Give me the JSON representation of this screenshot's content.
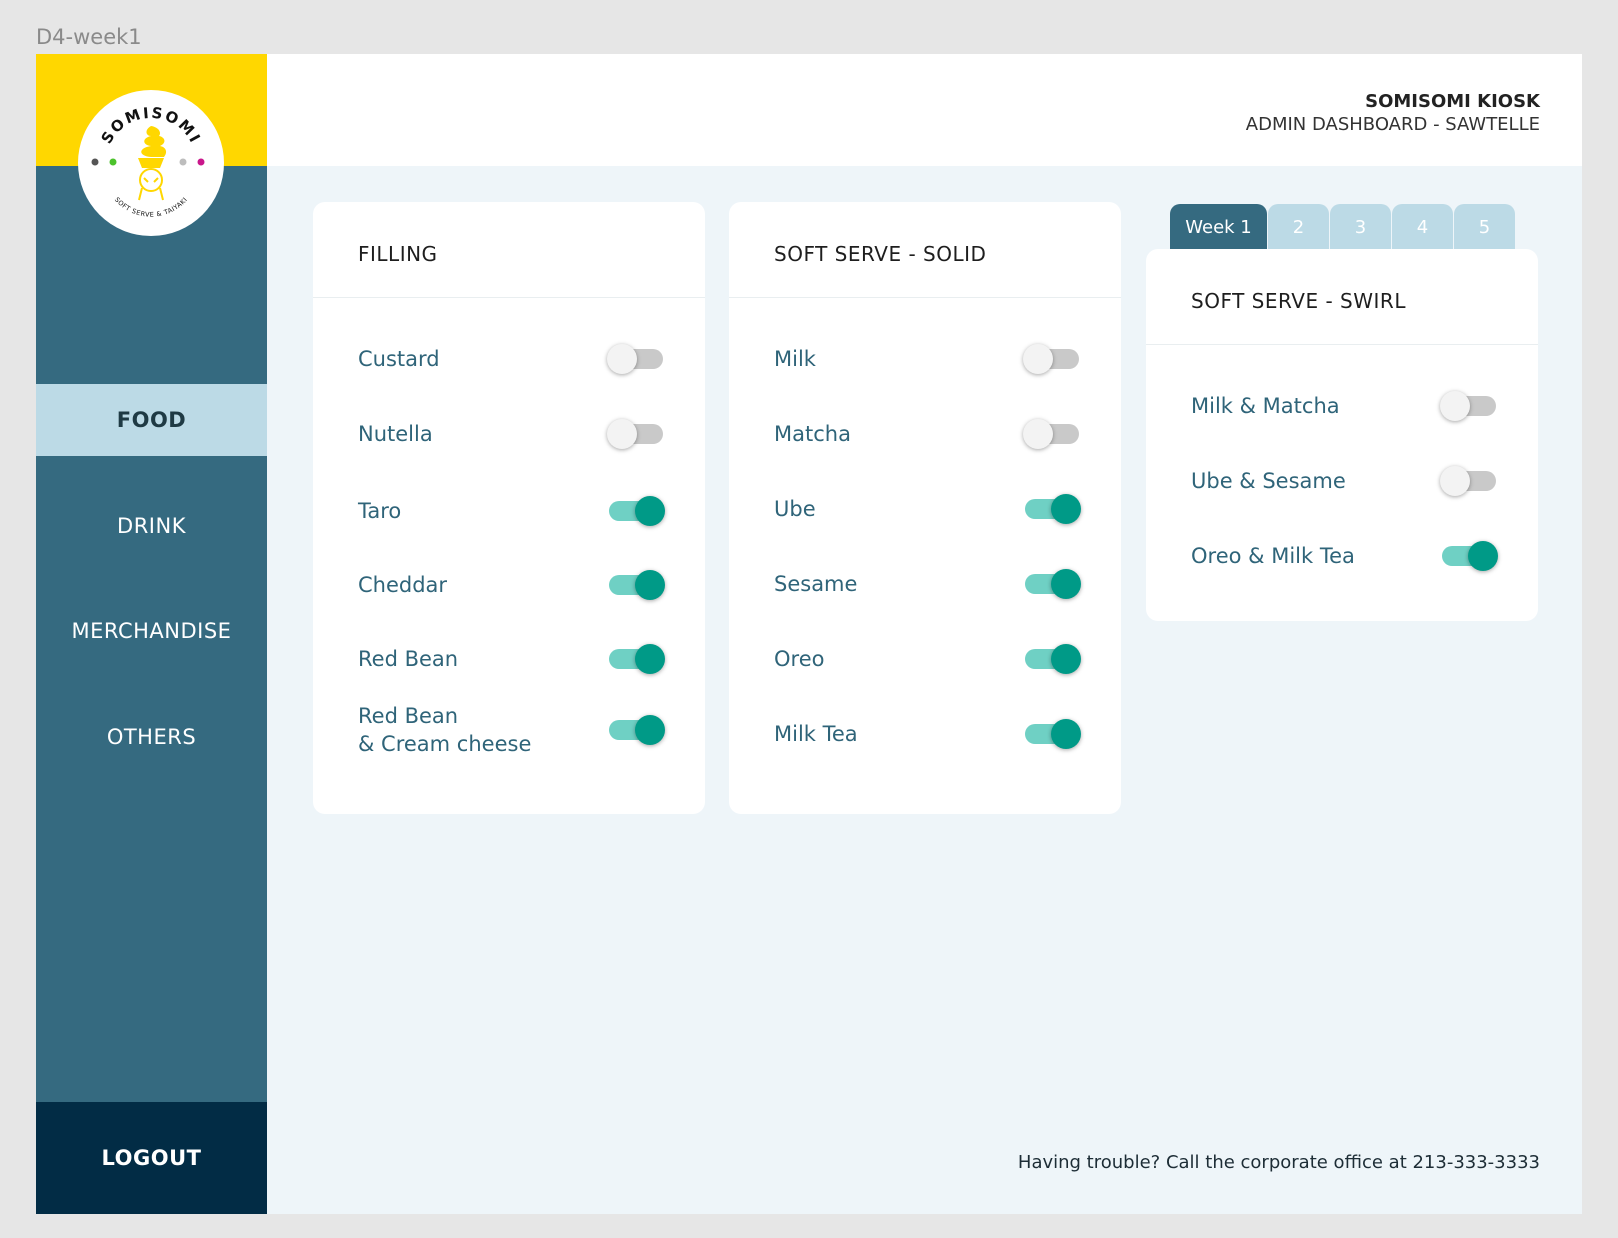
{
  "frame_label": "D4-week1",
  "logo": {
    "brand_text": "SOMISOMI",
    "tagline": "SOFT SERVE & TAIYAKI",
    "yellow": "#ffd700"
  },
  "header": {
    "title": "SOMISOMI KIOSK",
    "subtitle": "ADMIN DASHBOARD - SAWTELLE"
  },
  "sidebar": {
    "items": [
      {
        "label": "FOOD",
        "active": true
      },
      {
        "label": "DRINK",
        "active": false
      },
      {
        "label": "MERCHANDISE",
        "active": false
      },
      {
        "label": "OTHERS",
        "active": false
      }
    ],
    "logout_label": "LOGOUT"
  },
  "cards": [
    {
      "title": "FILLING",
      "items": [
        {
          "label": "Custard",
          "on": false
        },
        {
          "label": "Nutella",
          "on": false
        },
        {
          "label": "Taro",
          "on": true
        },
        {
          "label": "Cheddar",
          "on": true
        },
        {
          "label": "Red Bean",
          "on": true
        },
        {
          "label_line1": "Red Bean",
          "label_line2": "& Cream cheese",
          "on": true
        }
      ]
    },
    {
      "title": "SOFT SERVE - SOLID",
      "items": [
        {
          "label": "Milk",
          "on": false
        },
        {
          "label": "Matcha",
          "on": false
        },
        {
          "label": "Ube",
          "on": true
        },
        {
          "label": "Sesame",
          "on": true
        },
        {
          "label": "Oreo",
          "on": true
        },
        {
          "label": "Milk Tea",
          "on": true
        }
      ]
    },
    {
      "title": "SOFT SERVE - SWIRL",
      "items": [
        {
          "label": "Milk & Matcha",
          "on": false
        },
        {
          "label": "Ube & Sesame",
          "on": false
        },
        {
          "label": "Oreo & Milk Tea",
          "on": true
        }
      ]
    }
  ],
  "week_tabs": [
    {
      "label": "Week 1",
      "active": true
    },
    {
      "label": "2",
      "active": false
    },
    {
      "label": "3",
      "active": false
    },
    {
      "label": "4",
      "active": false
    },
    {
      "label": "5",
      "active": false
    }
  ],
  "footer": {
    "note": "Having trouble? Call the corporate office at 213-333-3333"
  },
  "colors": {
    "sidebar": "#356a80",
    "sidebar_active": "#bcdae6",
    "logout": "#022c45",
    "toggle_on_knob": "#009a87",
    "toggle_on_track": "#6fd0c4",
    "label_text": "#2f6479"
  }
}
